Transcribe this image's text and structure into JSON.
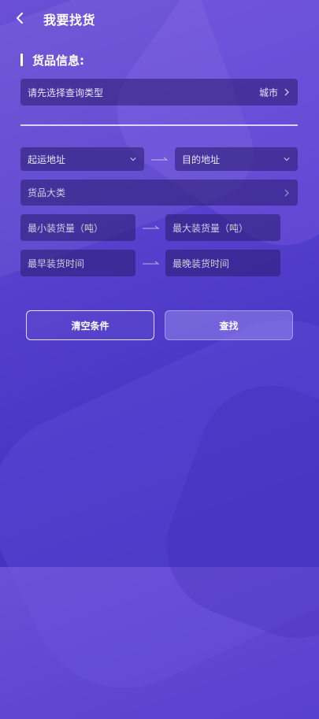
{
  "header": {
    "title": "我要找货",
    "back_icon": "chevron-left-icon"
  },
  "section": {
    "label": "货品信息:"
  },
  "query": {
    "placeholder": "请先选择查询类型",
    "value": "城市"
  },
  "route": {
    "origin_label": "起运地址",
    "destination_label": "目的地址"
  },
  "category": {
    "label": "货品大类"
  },
  "weight": {
    "min_label": "最小装货量（吨）",
    "max_label": "最大装货量（吨）"
  },
  "time": {
    "earliest_label": "最早装货时间",
    "latest_label": "最晚装货时间"
  },
  "actions": {
    "clear_label": "清空条件",
    "search_label": "查找"
  },
  "colors": {
    "accent": "#5a42cf",
    "field_bg": "#281c6e"
  }
}
